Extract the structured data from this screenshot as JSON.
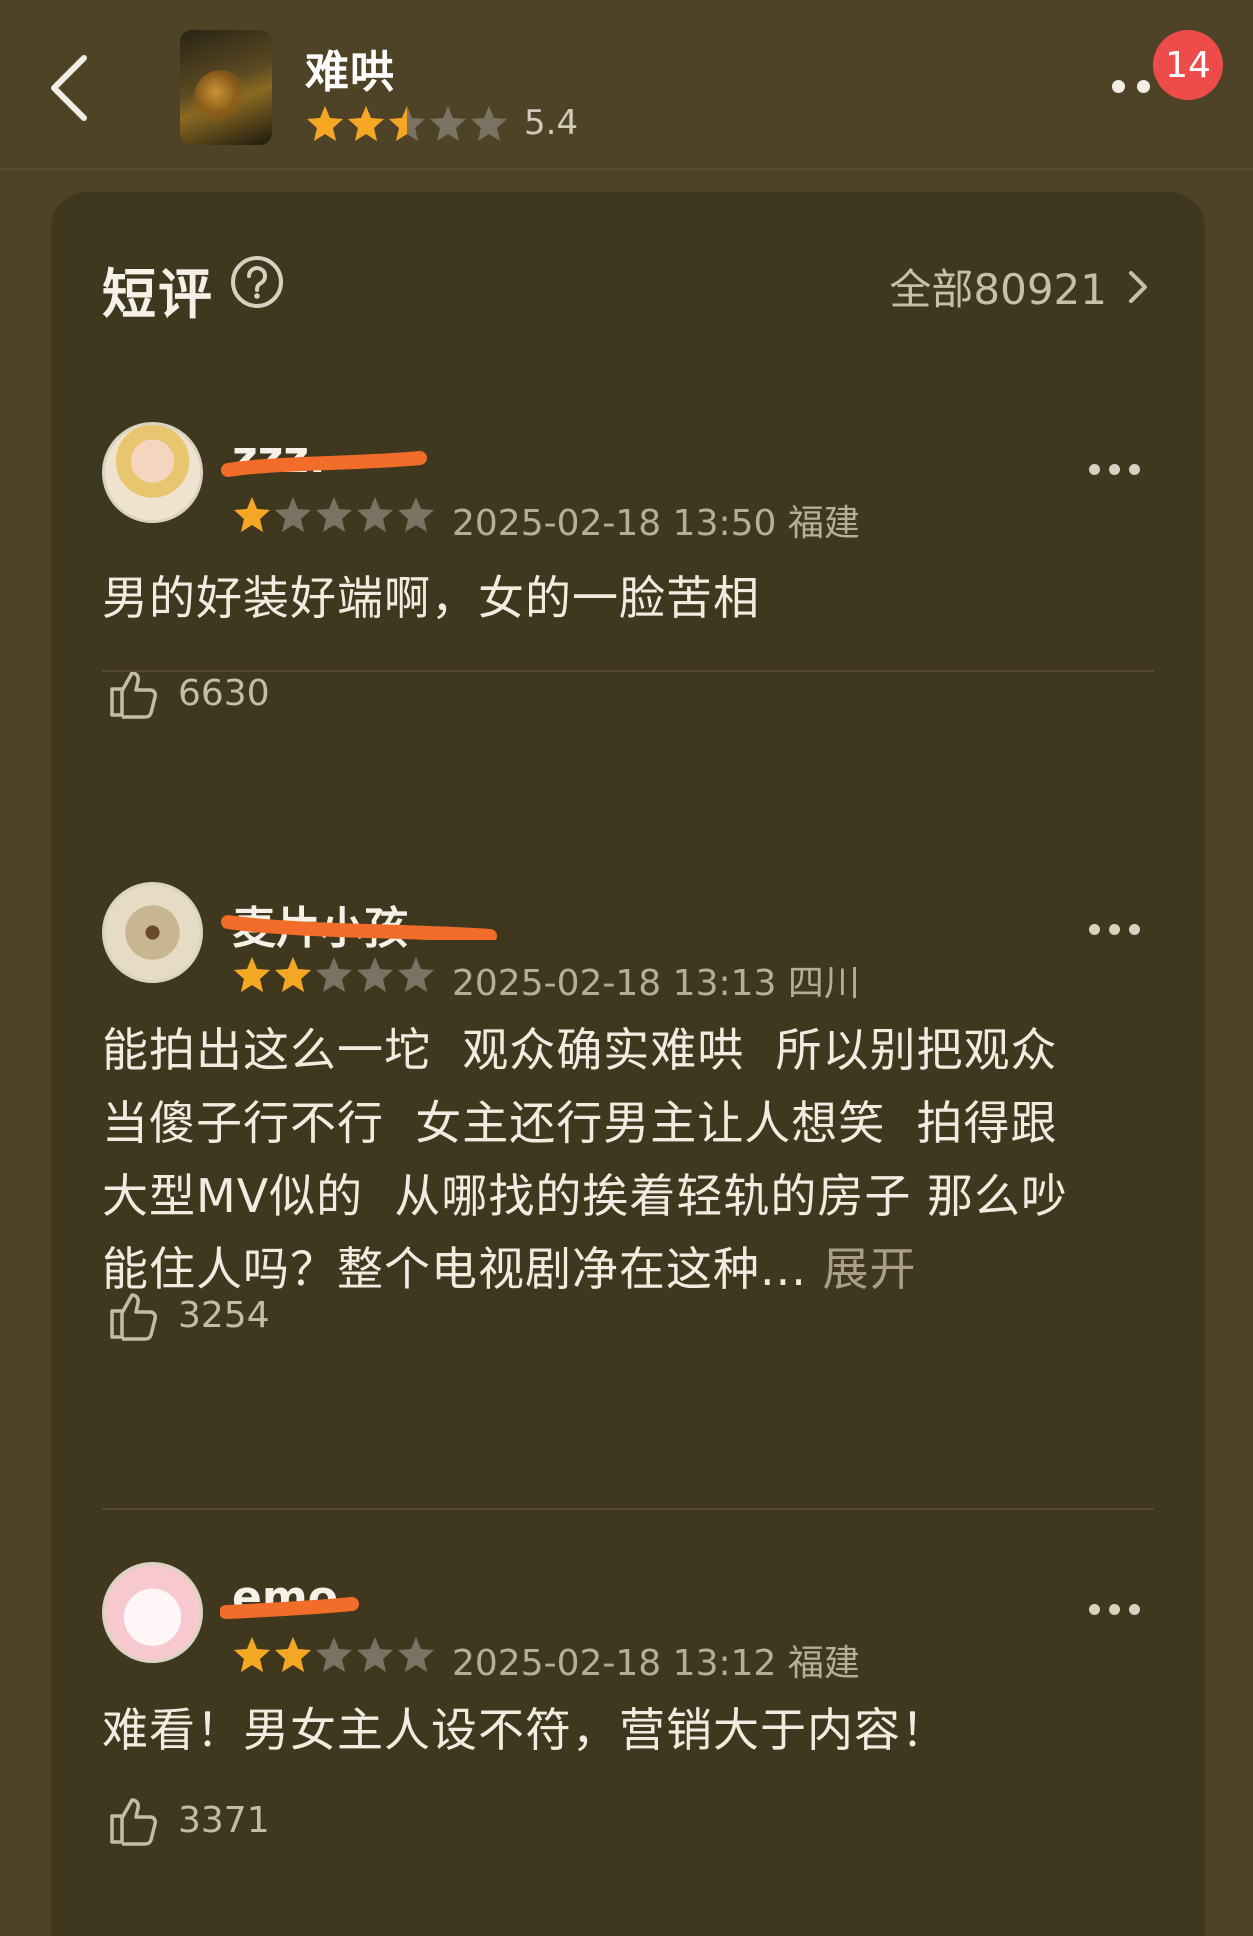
{
  "header": {
    "title": "难哄",
    "rating": 5.4,
    "rating_text": "5.4",
    "rating_stars": 2.5,
    "badge": "14",
    "icons": [
      "back-arrow-icon",
      "poster-thumbnail",
      "more-dots-icon"
    ]
  },
  "section": {
    "title": "短评",
    "help_icon": "question-circle-icon",
    "all_label": "全部80921"
  },
  "reviews": [
    {
      "username": "zzz.",
      "stars": 1,
      "meta": "2025-02-18 13:50 福建",
      "text": "男的好装好端啊，女的一脸苦相",
      "likes": "6630"
    },
    {
      "username": "麦片小孩",
      "stars": 2,
      "meta": "2025-02-18 13:13 四川",
      "text": "能拍出这么一坨  观众确实难哄  所以别把观众\n当傻子行不行  女主还行男主让人想笑  拍得跟\n大型MV似的  从哪找的挨着轻轨的房子 那么吵\n能住人吗？整个电视剧净在这种...",
      "expand": "展开",
      "likes": "3254"
    },
    {
      "username": "emo",
      "stars": 2,
      "meta": "2025-02-18 13:12 福建",
      "text": "难看！男女主人设不符，营销大于内容！",
      "likes": "3371"
    }
  ],
  "colors": {
    "background": "#4e4326",
    "card": "#40371f",
    "star_filled": "#f5a623",
    "star_empty": "#7a7262",
    "badge": "#ee4b4b",
    "scribble": "#f26d2a"
  }
}
